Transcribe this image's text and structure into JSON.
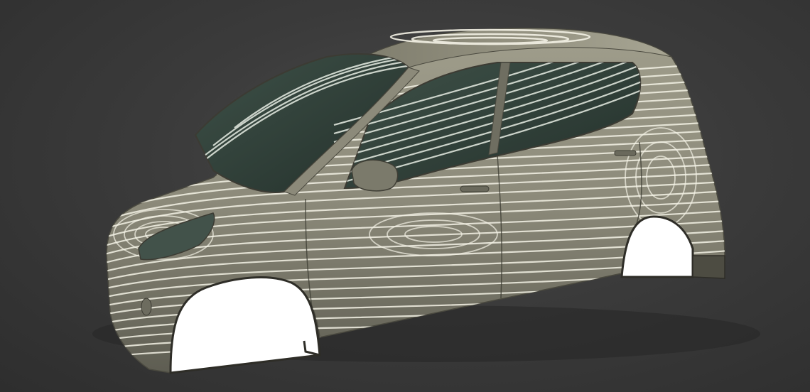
{
  "scene": {
    "subject": "car-body-zebra-reflection-render",
    "colors": {
      "background_center": "#4a4a4a",
      "background_edge": "#2e2e2e",
      "body_paint": "#8c8a7a",
      "body_shadow": "#55544a",
      "glass": "#2f3f38",
      "stripe": "#f4f2e6",
      "wheel_well": "#ffffff"
    },
    "icons": {
      "mirror": "side-mirror-shape",
      "headlight": "headlight-shape",
      "fog_light": "fog-light-shape"
    }
  }
}
